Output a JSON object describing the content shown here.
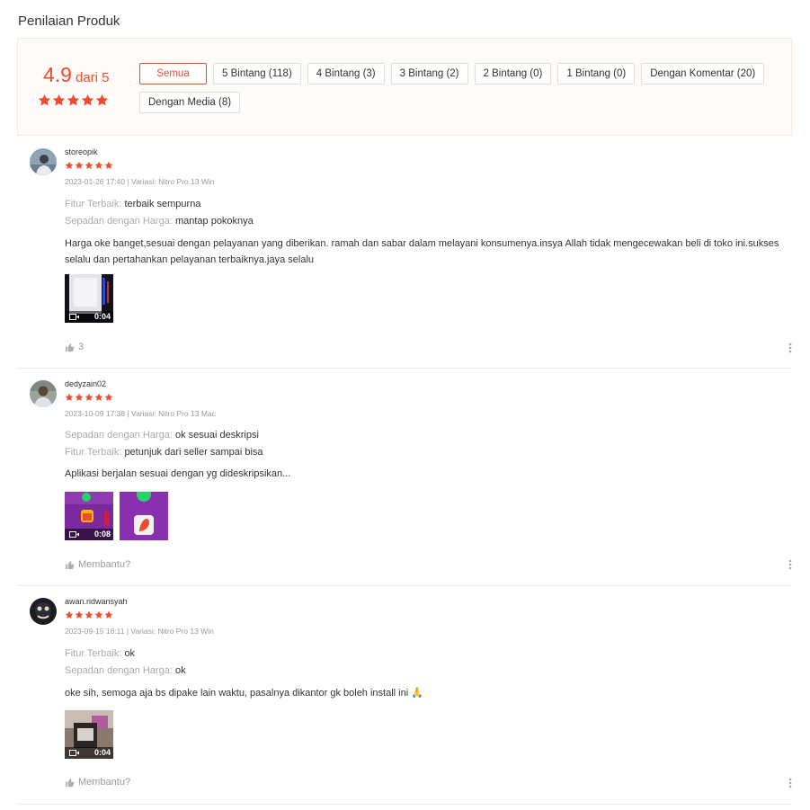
{
  "page_title": "Penilaian Produk",
  "overview": {
    "score": "4.9",
    "score_suffix": "dari 5",
    "filters": [
      "Semua",
      "5 Bintang (118)",
      "4 Bintang (3)",
      "3 Bintang (2)",
      "2 Bintang (0)",
      "1 Bintang (0)",
      "Dengan Komentar (20)",
      "Dengan Media (8)"
    ]
  },
  "reviews": [
    {
      "username": "storeopik",
      "rating": 5,
      "meta": "2023-01-26 17:40 | Variasi: Nitro Pro 13 Win",
      "fields": [
        {
          "label": "Fitur Terbaik:",
          "value": "terbaik sempurna"
        },
        {
          "label": "Sepadan dengan Harga:",
          "value": "mantap pokoknya"
        }
      ],
      "comment": "Harga oke banget,sesuai dengan pelayanan yang diberikan. ramah dan sabar dalam melayani konsumenya.insya Allah tidak mengecewakan beli di toko ini.sukses selalu dan pertahankan pelayanan terbaiknya.jaya selalu",
      "media": [
        {
          "duration": "0:04"
        }
      ],
      "like_text": "3"
    },
    {
      "username": "dedyzain02",
      "rating": 5,
      "meta": "2023-10-09 17:38 | Variasi: Nitro Pro 13 Mac",
      "fields": [
        {
          "label": "Sepadan dengan Harga:",
          "value": "ok sesuai deskripsi"
        },
        {
          "label": "Fitur Terbaik:",
          "value": "petunjuk dari seller sampai bisa"
        }
      ],
      "comment": "Aplikasi berjalan sesuai dengan  yg dideskripsikan...",
      "media": [
        {
          "duration": "0:08"
        },
        {
          "duration": ""
        }
      ],
      "like_text": "Membantu?"
    },
    {
      "username": "awan.ridwansyah",
      "rating": 5,
      "meta": "2023-09-15 16:11 | Variasi: Nitro Pro 13 Win",
      "fields": [
        {
          "label": "Fitur Terbaik:",
          "value": "ok"
        },
        {
          "label": "Sepadan dengan Harga:",
          "value": "ok"
        }
      ],
      "comment": "oke sih, semoga aja bs dipake lain waktu, pasalnya dikantor gk boleh install ini 🙏",
      "media": [
        {
          "duration": "0:04"
        }
      ],
      "like_text": "Membantu?"
    }
  ],
  "colors": {
    "accent": "#ee4d2d",
    "overview_bg": "#fffbf8",
    "muted": "#999999"
  },
  "icons": [
    "star-icon",
    "thumbs-up-icon",
    "more-vertical-icon",
    "video-camera-icon",
    "avatar"
  ]
}
